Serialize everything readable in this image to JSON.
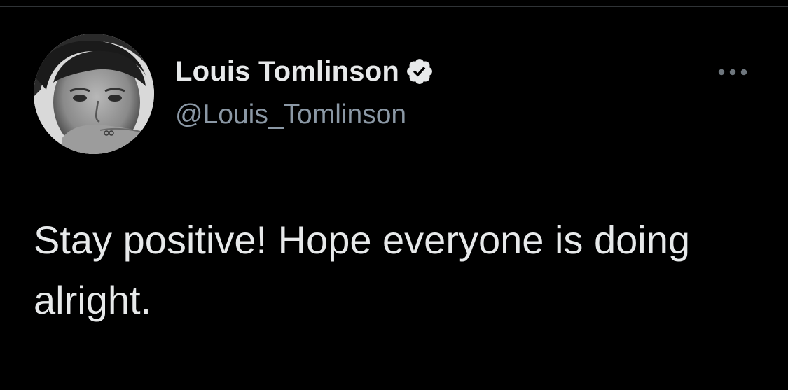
{
  "tweet": {
    "author": {
      "display_name": "Louis Tomlinson",
      "handle": "@Louis_Tomlinson",
      "verified": true,
      "avatar_icon": "profile-photo"
    },
    "more_icon": "ellipsis-icon",
    "text": "Stay positive! Hope everyone is doing alright."
  },
  "colors": {
    "background": "#000000",
    "primary_text": "#e7e9ea",
    "secondary_text": "#8b98a5",
    "divider": "#2f3336"
  }
}
